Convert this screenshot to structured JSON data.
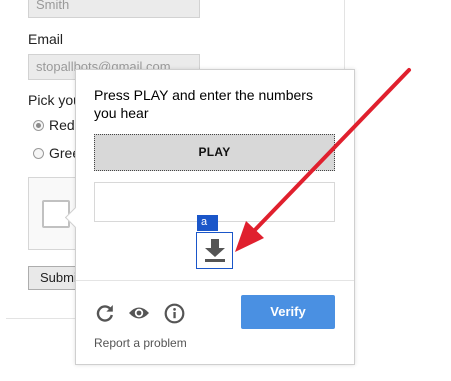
{
  "form": {
    "last_name_value": "Smith",
    "email_label": "Email",
    "email_value": "stopallbots@gmail.com",
    "pick_label": "Pick you",
    "options": [
      "Red",
      "Greer"
    ],
    "submit_label": "Submi"
  },
  "challenge": {
    "instructions": "Press PLAY and enter the numbers you hear",
    "play_label": "PLAY",
    "answer_value": "",
    "download_badge": "a",
    "verify_label": "Verify",
    "report_label": "Report a problem",
    "icons": [
      "reload-icon",
      "eye-icon",
      "info-icon",
      "download-icon"
    ]
  },
  "colors": {
    "verify_button": "#4a90e2",
    "badge": "#1a56c9",
    "annotation_arrow": "#e0202e"
  }
}
